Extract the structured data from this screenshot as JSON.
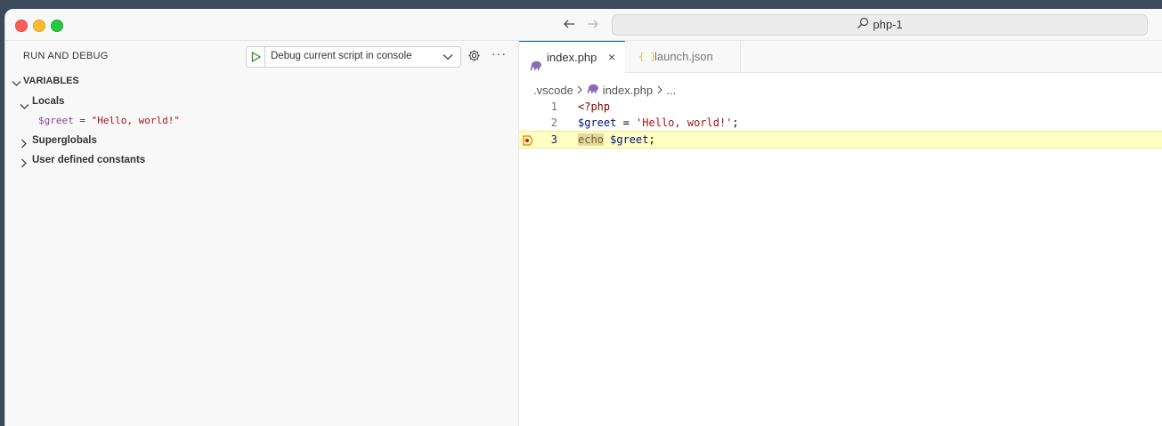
{
  "window": {
    "search_text": "php-1"
  },
  "sidebar": {
    "title": "RUN AND DEBUG",
    "config_label": "Debug current script in console",
    "more_label": "···",
    "variables_header": "VARIABLES",
    "tree": {
      "locals_label": "Locals",
      "local_var_name": "$greet",
      "local_var_eq": " = ",
      "local_var_value": "\"Hello, world!\"",
      "superglobals_label": "Superglobals",
      "constants_label": "User defined constants"
    }
  },
  "editor": {
    "tabs": [
      {
        "label": "index.php",
        "active": true,
        "close": "×"
      },
      {
        "label": "launch.json",
        "active": false,
        "icon_text": "{ }"
      }
    ],
    "breadcrumb": {
      "folder": ".vscode",
      "file": "index.php",
      "ellipsis": "..."
    },
    "lines": [
      {
        "num": "1",
        "tag": "<?php"
      },
      {
        "num": "2",
        "var": "$greet",
        "op": " = ",
        "str": "'Hello, world!'",
        "end": ";"
      },
      {
        "num": "3",
        "kw": "echo",
        "rest_var": " $greet",
        "end": ";"
      }
    ]
  },
  "colors": {
    "accent": "#005fb8",
    "php_icon": "#8c6bb1",
    "string": "#a31515",
    "variable": "#001080",
    "debug_line": "#ffffc2"
  }
}
